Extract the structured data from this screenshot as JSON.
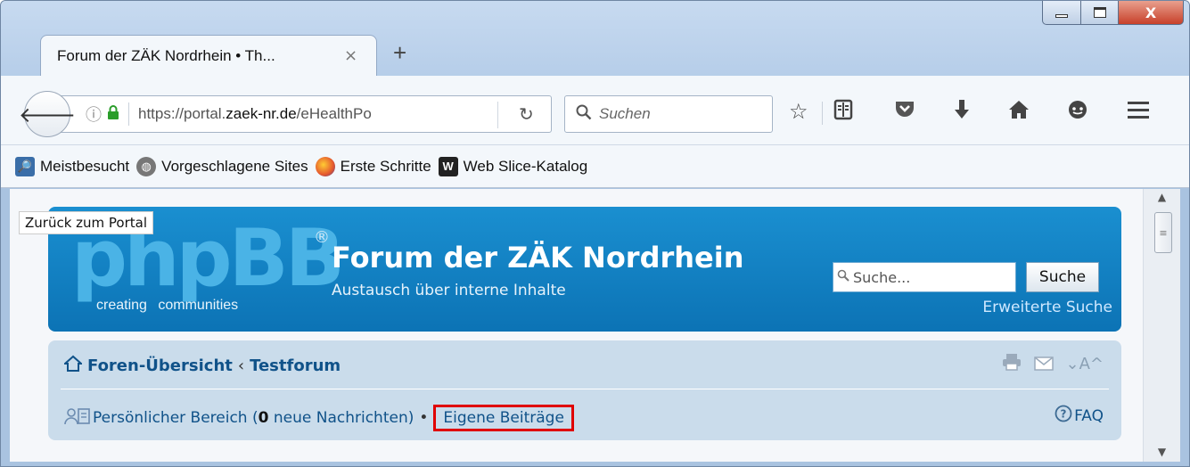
{
  "window": {
    "controls": {
      "minimize": "",
      "maximize": "",
      "close": "X"
    }
  },
  "tab": {
    "title": "Forum der ZÄK Nordrhein • Th...",
    "close": "×",
    "new_tab": "+"
  },
  "navbar": {
    "url_prefix": "https://portal.",
    "url_domain": "zaek-nr.de",
    "url_path": "/eHealthPo",
    "search_placeholder": "Suchen",
    "icons": [
      "back-icon",
      "info-icon",
      "lock-icon",
      "reload-icon",
      "search-icon",
      "bookmark-star-icon",
      "reading-list-icon",
      "pocket-icon",
      "download-icon",
      "home-icon",
      "chat-icon",
      "menu-icon"
    ]
  },
  "bookmarks": [
    {
      "label": "Meistbesucht",
      "icon": "most-visited-icon"
    },
    {
      "label": "Vorgeschlagene Sites",
      "icon": "globe-icon"
    },
    {
      "label": "Erste Schritte",
      "icon": "firefox-icon"
    },
    {
      "label": "Web Slice-Katalog",
      "icon": "web-slice-icon"
    }
  ],
  "page": {
    "back_to_portal": "Zurück zum Portal",
    "logo": {
      "main": "phpBB",
      "reg": "®",
      "tag1": "creating",
      "tag2": "communities"
    },
    "site_title": "Forum der ZÄK Nordrhein",
    "site_description": "Austausch über interne Inhalte",
    "search_placeholder": "Suche...",
    "search_button": "Suche",
    "advanced_search": "Erweiterte Suche",
    "breadcrumb": {
      "home": "Foren-Übersicht",
      "separator": "‹",
      "current": "Testforum"
    },
    "user_links": {
      "personal_area_prefix": "Persönlicher Bereich (",
      "new_messages_count": "0",
      "personal_area_suffix": " neue Nachrichten)",
      "bullet": "•",
      "own_posts": "Eigene Beiträge"
    },
    "faq": "FAQ",
    "highlight_color": "#e00000"
  }
}
